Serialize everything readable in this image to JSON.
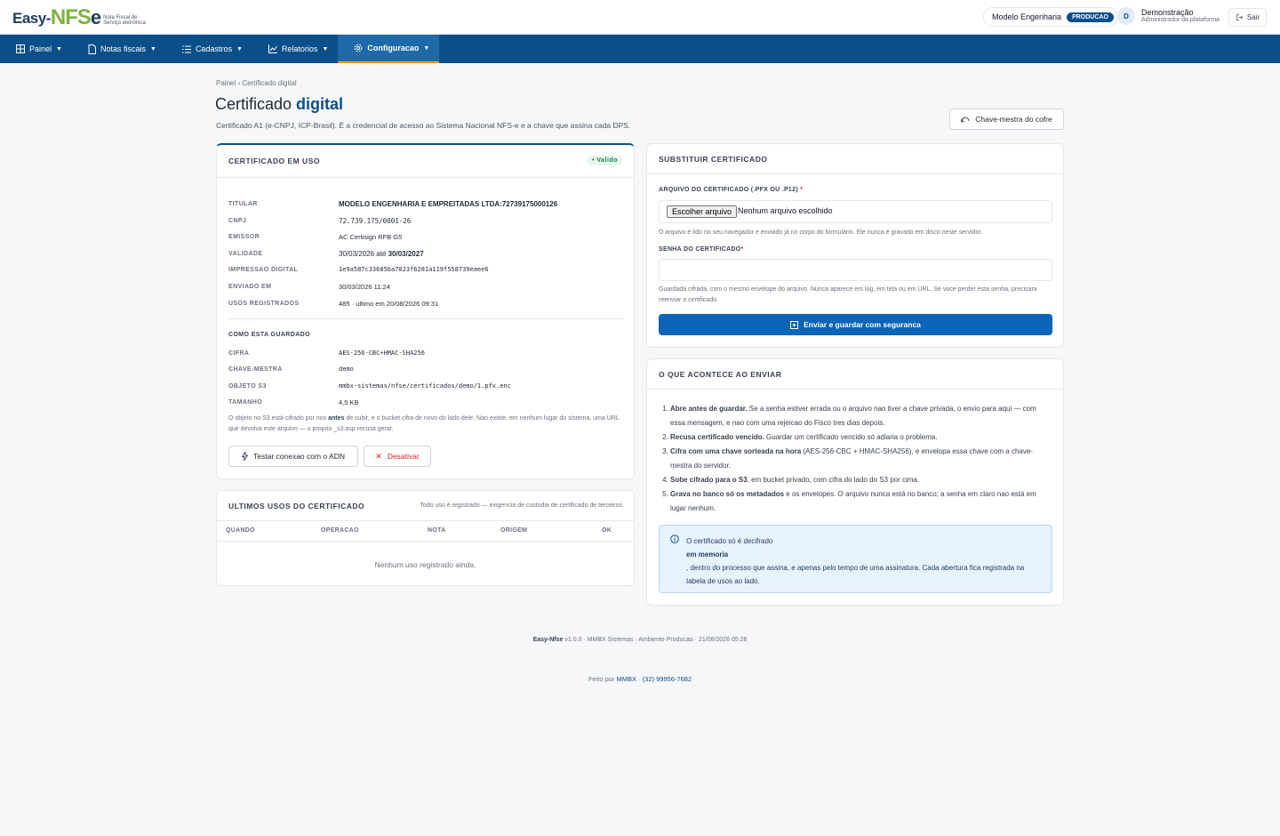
{
  "brand": {
    "logo_easy": "Easy-",
    "logo_nfs": "NFS",
    "logo_e": "e",
    "logo_sub": "Nota Fiscal de Serviço eletrônica"
  },
  "header": {
    "tenant": "Modelo Engenharia",
    "env_badge": "PRODUCAO",
    "user_initial": "D",
    "user_name": "Demonstração",
    "user_role": "Administrador da plataforma",
    "logout": "Sair"
  },
  "nav": [
    {
      "label": "Painel",
      "icon": "grid-icon"
    },
    {
      "label": "Notas fiscais",
      "icon": "document-icon"
    },
    {
      "label": "Cadastros",
      "icon": "list-icon"
    },
    {
      "label": "Relatorios",
      "icon": "chart-icon"
    },
    {
      "label": "Configuracao",
      "icon": "gear-icon",
      "active": true
    }
  ],
  "page": {
    "breadcrumb": "Painel › Certificado digital",
    "title_plain": "Certificado ",
    "title_bold": "digital",
    "subtitle": "Certificado A1 (e-CNPJ, ICP-Brasil). É a credencial de acesso ao Sistema Nacional NFS-e e a chave que assina cada DPS.",
    "vault_button": "Chave-mestra do cofre"
  },
  "current_cert": {
    "heading": "CERTIFICADO EM USO",
    "status": "• Valido",
    "fields": [
      {
        "label": "TITULAR",
        "value": "MODELO ENGENHARIA E EMPREITADAS LTDA:72739175000126"
      },
      {
        "label": "CNPJ",
        "value": "72.739.175/0001-26"
      },
      {
        "label": "EMISSOR",
        "value": "AC Certisign RFB G5"
      },
      {
        "label": "VALIDADE",
        "value_prefix": "30/03/2026 até ",
        "value_bold": "30/03/2027"
      },
      {
        "label": "IMPRESSAO DIGITAL",
        "value": "1e9a587c33685ba7023f6281a119f558739eaee6"
      },
      {
        "label": "ENVIADO EM",
        "value": "30/03/2026 11:24"
      },
      {
        "label": "USOS REGISTRADOS",
        "value": "485 · ultimo em 20/08/2026 09:31"
      }
    ],
    "storage_heading": "COMO ESTA GUARDADO",
    "storage": [
      {
        "label": "CIFRA",
        "value": "AES-256-CBC+HMAC-SHA256"
      },
      {
        "label": "CHAVE-MESTRA",
        "value": "demo"
      },
      {
        "label": "OBJETO S3",
        "value": "mmbx-sistemas/nfse/certificados/demo/1.pfx.enc"
      },
      {
        "label": "TAMANHO",
        "value": "4,5 KB"
      }
    ],
    "storage_note_1": "O objeto no S3 está cifrado por nos ",
    "storage_note_bold": "antes",
    "storage_note_2": " de subir, e o bucket cifra de novo do lado dele. Nao existe, em nenhum lugar do sistema, uma URL que devolva este arquivo — o proprio _s3.asp recusa gerar.",
    "test_button": "Testar conexao com o ADN",
    "disable_button": "Desativar"
  },
  "usage": {
    "heading": "ULTIMOS USOS DO CERTIFICADO",
    "hint": "Todo uso é registrado — exigencia de custodia de certificado de terceiros",
    "columns": [
      "QUANDO",
      "OPERACAO",
      "NOTA",
      "ORIGEM",
      "OK"
    ],
    "empty": "Nenhum uso registrado ainda."
  },
  "replace": {
    "heading": "SUBSTITUIR CERTIFICADO",
    "file_label": "ARQUIVO DO CERTIFICADO (.PFX OU .P12)",
    "req": "*",
    "file_button": "Escolher arquivo",
    "file_status": "Nenhum arquivo escolhido",
    "file_help": "O arquivo é lido no seu navegador e enviado já no corpo do formulario. Ele nunca é gravado em disco neste servidor.",
    "password_label": "SENHA DO CERTIFICADO",
    "password_help": "Guardada cifrada, com o mesmo envelope do arquivo. Nunca aparece em log, em tela ou em URL. Se voce perder esta senha, precisara reenviar o certificado.",
    "submit": "Enviar e guardar com seguranca"
  },
  "steps": {
    "heading": "O QUE ACONTECE AO ENVIAR",
    "items": [
      {
        "bold": "Abre antes de guardar.",
        "text": " Se a senha estiver errada ou o arquivo nao tiver a chave privada, o envio para aqui — com essa mensagem, e nao com uma rejeicao do Fisco tres dias depois."
      },
      {
        "bold": "Recusa certificado vencido.",
        "text": " Guardar um certificado vencido só adiaria o problema."
      },
      {
        "bold": "Cifra com uma chave sorteada na hora",
        "text": " (AES-256-CBC + HMAC-SHA256), e envelopa essa chave com a chave-mestra do servidor."
      },
      {
        "bold": "Sobe cifrado para o S3",
        "text": ", em bucket privado, com cifra do lado do S3 por cima."
      },
      {
        "bold": "Grava no banco só os metadados",
        "text": " e os envelopes. O arquivo nunca está no banco; a senha em claro nao está em lugar nenhum."
      }
    ],
    "info_1": "O certificado só é decifrado",
    "info_bold": "em memoria",
    "info_2": ", dentro do processo que assina, e apenas pelo tempo de uma assinatura. Cada abertura fica registrada na tabela de usos ao lado."
  },
  "footer": {
    "app": "Easy-Nfse",
    "meta": " v1.0.0 · MMBX Sistemas · Ambiente Producao · 21/08/2026 05:26",
    "made_by": "Feito por ",
    "company": "MMBX",
    "sep": " · ",
    "phone": "(32) 99956-7682"
  },
  "colors": {
    "primary": "#0b4f8a",
    "accent_green": "#7cb342",
    "danger": "#dc2626",
    "success": "#15803d"
  }
}
